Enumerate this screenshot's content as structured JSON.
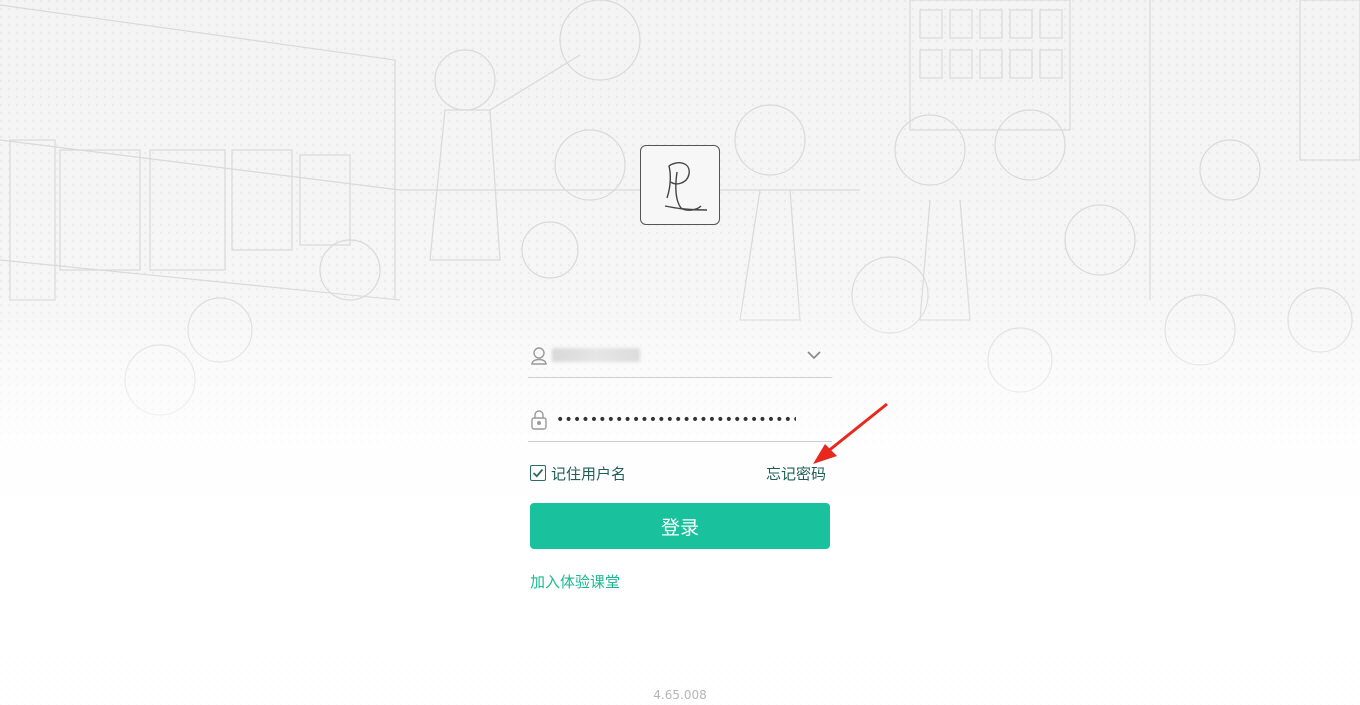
{
  "username": {
    "icon": "user-icon",
    "value_blurred": true,
    "dropdown_icon": "chevron-down-icon"
  },
  "password": {
    "icon": "lock-icon",
    "value": "••••••••••••••••••••••••••••••"
  },
  "remember": {
    "label": "记住用户名",
    "checked": true
  },
  "forgot_label": "忘记密码",
  "login_label": "登录",
  "join_label": "加入体验课堂",
  "version": "4.65.008",
  "colors": {
    "accent": "#19c29d",
    "link_dark": "#1e5e54",
    "annotation_arrow": "#e8281e"
  },
  "logo_icon": "pl-logo-icon"
}
